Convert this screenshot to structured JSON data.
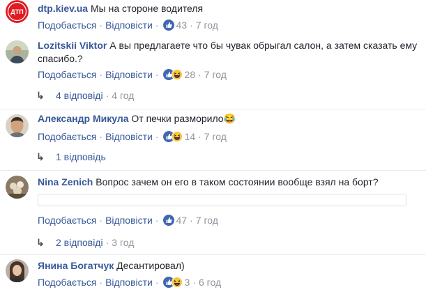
{
  "labels": {
    "like": "Подобається",
    "reply": "Відповісти"
  },
  "comments": [
    {
      "author": "dtp.kiev.ua",
      "text": "Мы на стороне водителя",
      "reactions": "43",
      "time": "7 год"
    },
    {
      "author": "Lozitskii Viktor",
      "text": "А вы предлагаете что бы чувак обрыгал салон, а затем сказать ему спасибо.?",
      "reactions": "28",
      "time": "7 год",
      "replies": "4 відповіді",
      "replies_time": "4 год"
    },
    {
      "author": "Александр Микула",
      "text": "От печки разморило",
      "emoji": "😂",
      "reactions": "14",
      "time": "7 год",
      "replies": "1 відповідь"
    },
    {
      "author": "Nina Zenich",
      "text": "Вопрос зачем он его в таком состоянии вообще взял на борт?",
      "reactions": "47",
      "time": "7 год",
      "replies": "2 відповіді",
      "replies_time": "3 год"
    },
    {
      "author": "Янина Богатчук",
      "text": "Десантировал)",
      "reactions": "3",
      "time": "6 год"
    }
  ],
  "avatar_badge": "ДТП"
}
